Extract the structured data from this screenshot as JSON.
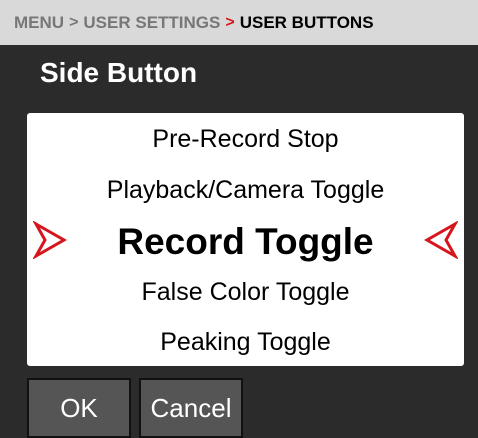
{
  "breadcrumb": {
    "items": [
      "MENU",
      "USER SETTINGS",
      "USER BUTTONS"
    ],
    "separator": ">"
  },
  "title": "Side Button",
  "picker": {
    "options": [
      "Pre-Record Stop",
      "Playback/Camera Toggle",
      "Record Toggle",
      "False Color Toggle",
      "Peaking Toggle"
    ],
    "selected": "Record Toggle",
    "left_arrow_icon": "red-chevron-right-icon",
    "right_arrow_icon": "red-chevron-left-icon"
  },
  "buttons": {
    "ok_label": "OK",
    "cancel_label": "Cancel"
  },
  "colors": {
    "background": "#2b2b2b",
    "breadcrumb_bg": "#d9d9d9",
    "accent_red": "#d6151c",
    "button_bg": "#555555"
  }
}
